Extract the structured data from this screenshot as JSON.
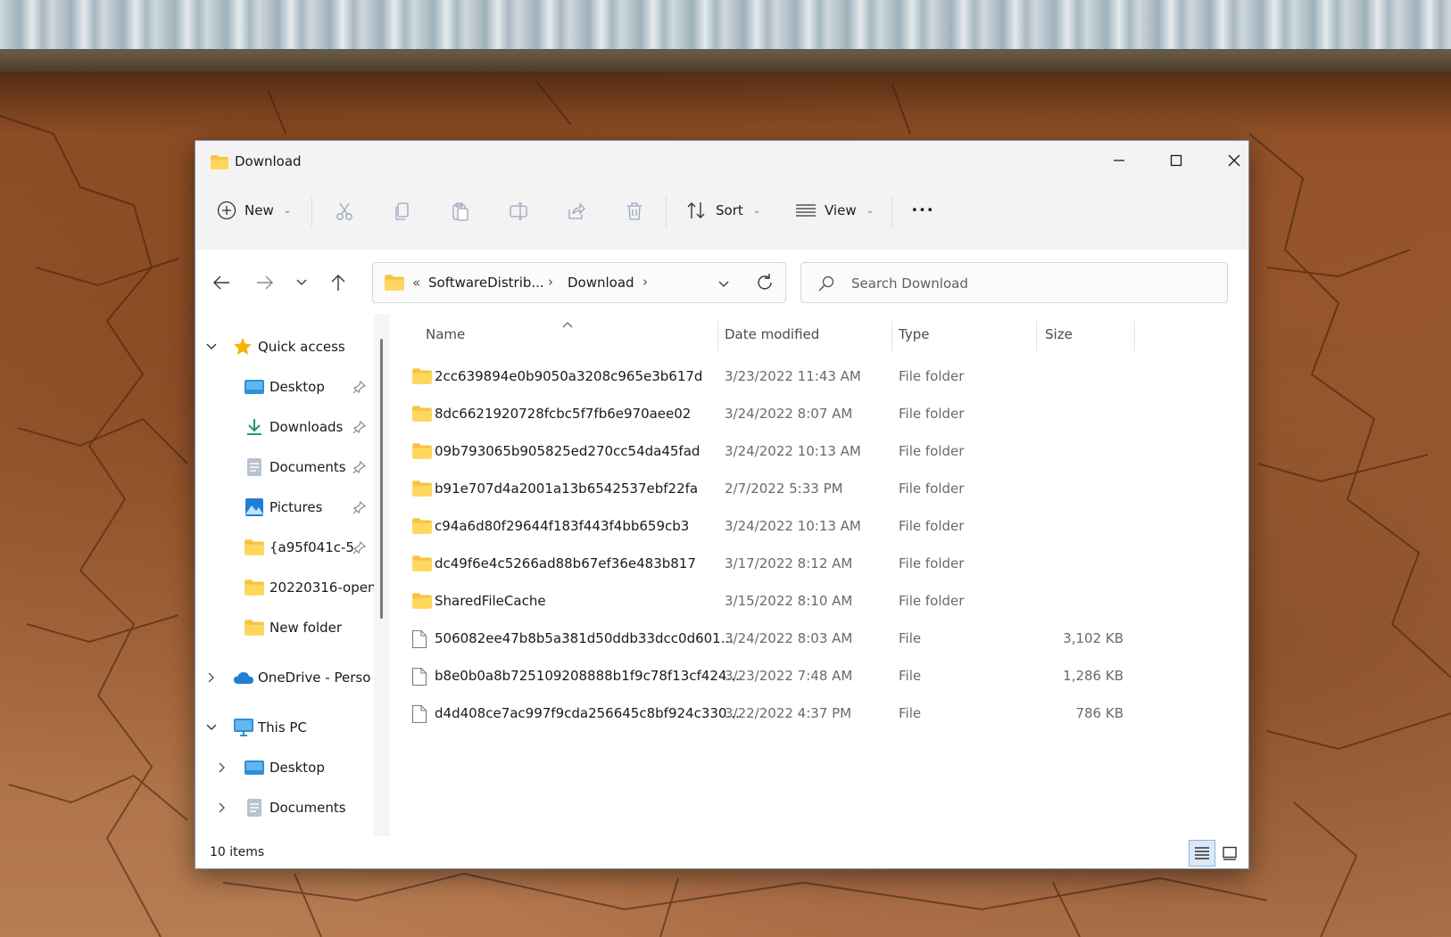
{
  "window": {
    "title": "Download"
  },
  "toolbar": {
    "new_label": "New",
    "sort_label": "Sort",
    "view_label": "View",
    "more_label": "•••"
  },
  "address": {
    "overflow": "«",
    "crumbs": [
      "SoftwareDistrib...",
      "Download"
    ],
    "separator": "›"
  },
  "search": {
    "placeholder": "Search Download"
  },
  "sidebar": {
    "items": [
      {
        "label": "Quick access",
        "icon": "star-icon",
        "expanded": true
      },
      {
        "label": "Desktop",
        "icon": "desktop-icon",
        "pinned": true
      },
      {
        "label": "Downloads",
        "icon": "download-icon",
        "pinned": true
      },
      {
        "label": "Documents",
        "icon": "document-icon",
        "pinned": true
      },
      {
        "label": "Pictures",
        "icon": "pictures-icon",
        "pinned": true
      },
      {
        "label": "{a95f041c-5",
        "icon": "folder-icon",
        "pinned": true
      },
      {
        "label": "20220316-open",
        "icon": "folder-icon"
      },
      {
        "label": "New folder",
        "icon": "folder-icon"
      },
      {
        "label": "OneDrive - Perso",
        "icon": "cloud-icon",
        "expanded": false
      },
      {
        "label": "This PC",
        "icon": "pc-icon",
        "expanded": true
      },
      {
        "label": "Desktop",
        "icon": "desktop-icon",
        "expanded": false
      },
      {
        "label": "Documents",
        "icon": "document-icon",
        "expanded": false
      }
    ]
  },
  "columns": {
    "name": "Name",
    "date": "Date modified",
    "type": "Type",
    "size": "Size"
  },
  "files": [
    {
      "name": "2cc639894e0b9050a3208c965e3b617d",
      "date": "3/23/2022 11:43 AM",
      "type": "File folder",
      "size": "",
      "kind": "folder"
    },
    {
      "name": "8dc6621920728fcbc5f7fb6e970aee02",
      "date": "3/24/2022 8:07 AM",
      "type": "File folder",
      "size": "",
      "kind": "folder"
    },
    {
      "name": "09b793065b905825ed270cc54da45fad",
      "date": "3/24/2022 10:13 AM",
      "type": "File folder",
      "size": "",
      "kind": "folder"
    },
    {
      "name": "b91e707d4a2001a13b6542537ebf22fa",
      "date": "2/7/2022 5:33 PM",
      "type": "File folder",
      "size": "",
      "kind": "folder"
    },
    {
      "name": "c94a6d80f29644f183f443f4bb659cb3",
      "date": "3/24/2022 10:13 AM",
      "type": "File folder",
      "size": "",
      "kind": "folder"
    },
    {
      "name": "dc49f6e4c5266ad88b67ef36e483b817",
      "date": "3/17/2022 8:12 AM",
      "type": "File folder",
      "size": "",
      "kind": "folder"
    },
    {
      "name": "SharedFileCache",
      "date": "3/15/2022 8:10 AM",
      "type": "File folder",
      "size": "",
      "kind": "folder"
    },
    {
      "name": "506082ee47b8b5a381d50ddb33dcc0d601...",
      "date": "3/24/2022 8:03 AM",
      "type": "File",
      "size": "3,102 KB",
      "kind": "file"
    },
    {
      "name": "b8e0b0a8b725109208888b1f9c78f13cf424...",
      "date": "3/23/2022 7:48 AM",
      "type": "File",
      "size": "1,286 KB",
      "kind": "file"
    },
    {
      "name": "d4d408ce7ac997f9cda256645c8bf924c330...",
      "date": "3/22/2022 4:37 PM",
      "type": "File",
      "size": "786 KB",
      "kind": "file"
    }
  ],
  "status": {
    "item_count": "10 items"
  },
  "colors": {
    "folder": "#f5c542",
    "accent": "#0067c0"
  }
}
